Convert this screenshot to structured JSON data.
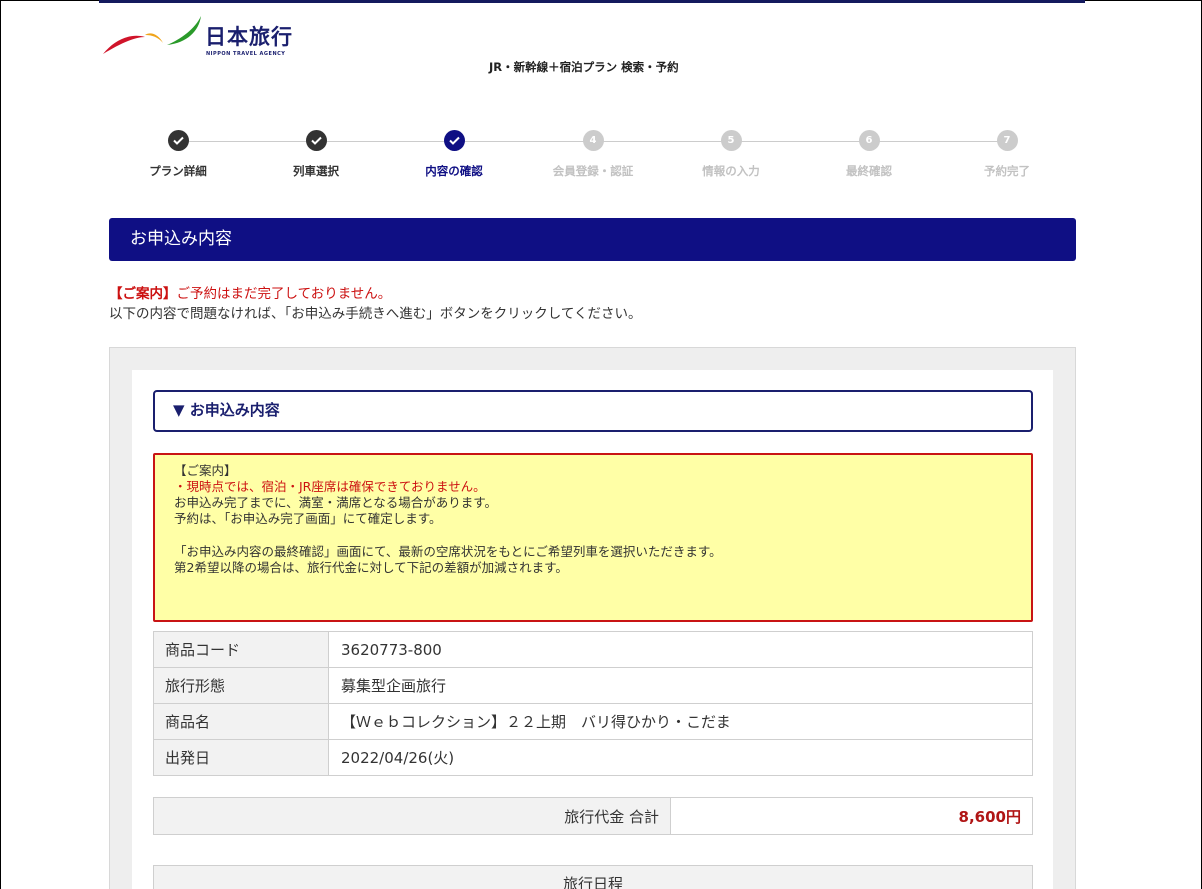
{
  "header": {
    "logo_text": "日本旅行",
    "logo_sub": "NIPPON TRAVEL AGENCY",
    "title": "JR・新幹線＋宿泊プラン 検索・予約"
  },
  "stepper": {
    "steps": [
      {
        "label": "プラン詳細",
        "number": "",
        "state": "done"
      },
      {
        "label": "列車選択",
        "number": "",
        "state": "done"
      },
      {
        "label": "内容の確認",
        "number": "",
        "state": "current"
      },
      {
        "label": "会員登録・認証",
        "number": "4",
        "state": "upcoming"
      },
      {
        "label": "情報の入力",
        "number": "5",
        "state": "upcoming"
      },
      {
        "label": "最終確認",
        "number": "6",
        "state": "upcoming"
      },
      {
        "label": "予約完了",
        "number": "7",
        "state": "upcoming"
      }
    ]
  },
  "section": {
    "title": "お申込み内容"
  },
  "notice": {
    "tag": "【ご案内】",
    "warning": "ご予約はまだ完了しておりません。",
    "instruction": "以下の内容で問題なければ、「お申込み手続きへ進む」ボタンをクリックしてください。"
  },
  "detail": {
    "header": "▼ お申込み内容",
    "caution": {
      "title": "【ご案内】",
      "red_line": "・現時点では、宿泊・JR座席は確保できておりません。",
      "line2": "お申込み完了までに、満室・満席となる場合があります。",
      "line3": "予約は、「お申込み完了画面」にて確定します。",
      "line4": "「お申込み内容の最終確認」画面にて、最新の空席状況をもとにご希望列車を選択いただきます。",
      "line5": "第2希望以降の場合は、旅行代金に対して下記の差額が加減されます。"
    },
    "rows": [
      {
        "key": "商品コード",
        "value": "3620773-800"
      },
      {
        "key": "旅行形態",
        "value": "募集型企画旅行"
      },
      {
        "key": "商品名",
        "value": "【Ｗｅｂコレクション】２２上期　バリ得ひかり・こだま"
      },
      {
        "key": "出発日",
        "value": "2022/04/26(火)"
      }
    ],
    "total_label": "旅行代金 合計",
    "total_value": "8,600円",
    "itinerary_label": "旅行日程"
  },
  "colors": {
    "navy": "#0f0f84",
    "done": "#333333",
    "upcoming": "#cccccc",
    "caution_bg": "#ffffa6",
    "caution_border": "#c81414",
    "price": "#b01515"
  }
}
